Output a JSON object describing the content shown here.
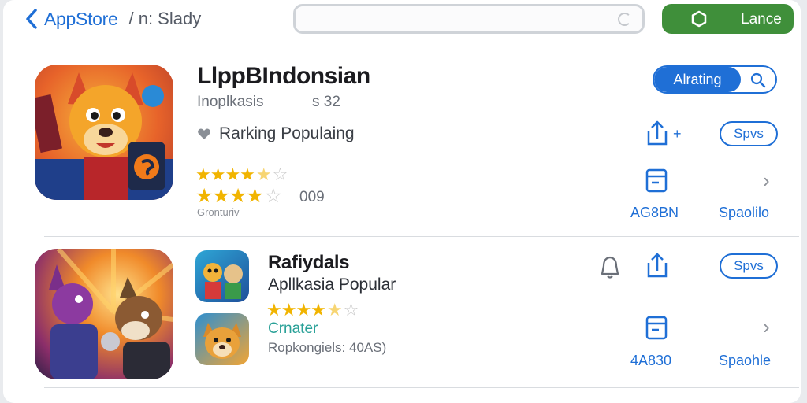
{
  "topbar": {
    "back_label": "AppStore",
    "crumb": "/ n: Slady",
    "green_button_label": "Lance"
  },
  "app1": {
    "title": "LlppBIndonsian",
    "subtitle": "Inoplkasis",
    "count": "s 32",
    "ranking": "Rarking Populaing",
    "stars_label": "009",
    "tiny_label": "Gronturiv",
    "toggle_label": "Alrating",
    "pill_label": "Spvs",
    "code_label": "AG8BN",
    "link_label": "Spaolilo"
  },
  "app2": {
    "title": "Rafiydals",
    "subtitle": "Apllkasia Popular",
    "green_label": "Crnater",
    "rank_label": "Ropkongiels: 40AS)",
    "pill_label": "Spvs",
    "code_label": "4A830",
    "link_label": "Spaohle"
  },
  "colors": {
    "accent": "#1f6fd6",
    "green": "#3f8f3a",
    "star": "#f1b400"
  },
  "icons": [
    "chevron-left-icon",
    "spinner-icon",
    "hexagon-icon",
    "search-icon",
    "share-icon",
    "calendar-icon",
    "chevron-right-icon",
    "heart-icon",
    "bell-icon"
  ]
}
